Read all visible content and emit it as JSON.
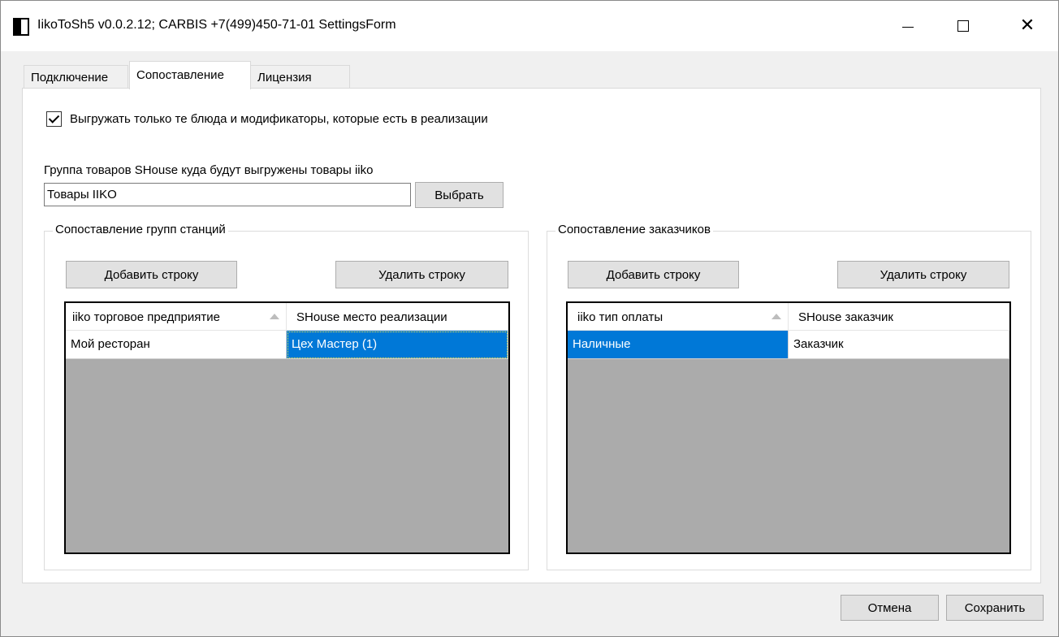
{
  "window": {
    "title": "IikoToSh5 v0.0.2.12;  CARBIS +7(499)450-71-01 SettingsForm"
  },
  "tabs": [
    {
      "label": "Подключение"
    },
    {
      "label": "Сопоставление"
    },
    {
      "label": "Лицензия"
    }
  ],
  "options": {
    "only_sold_label": "Выгружать только те блюда и модификаторы, которые есть в реализации",
    "only_sold_checked": true
  },
  "product_group": {
    "label": "Группа товаров SHouse куда будут выгружены товары iiko",
    "value": "Товары IIKO",
    "choose_label": "Выбрать"
  },
  "stations_mapping": {
    "title": "Сопоставление групп станций",
    "add_label": "Добавить строку",
    "delete_label": "Удалить строку",
    "columns": [
      "iiko торговое предприятие",
      "SHouse место реализации"
    ],
    "rows": [
      [
        "Мой ресторан",
        "Цех Мастер (1)"
      ]
    ]
  },
  "customers_mapping": {
    "title": "Сопоставление заказчиков",
    "add_label": "Добавить строку",
    "delete_label": "Удалить строку",
    "columns": [
      "iiko тип оплаты",
      "SHouse заказчик"
    ],
    "rows": [
      [
        "Наличные",
        "Заказчик"
      ]
    ]
  },
  "footer": {
    "cancel_label": "Отмена",
    "save_label": "Сохранить"
  },
  "colors": {
    "selection": "#0078d7",
    "grid_background": "#ababab"
  }
}
